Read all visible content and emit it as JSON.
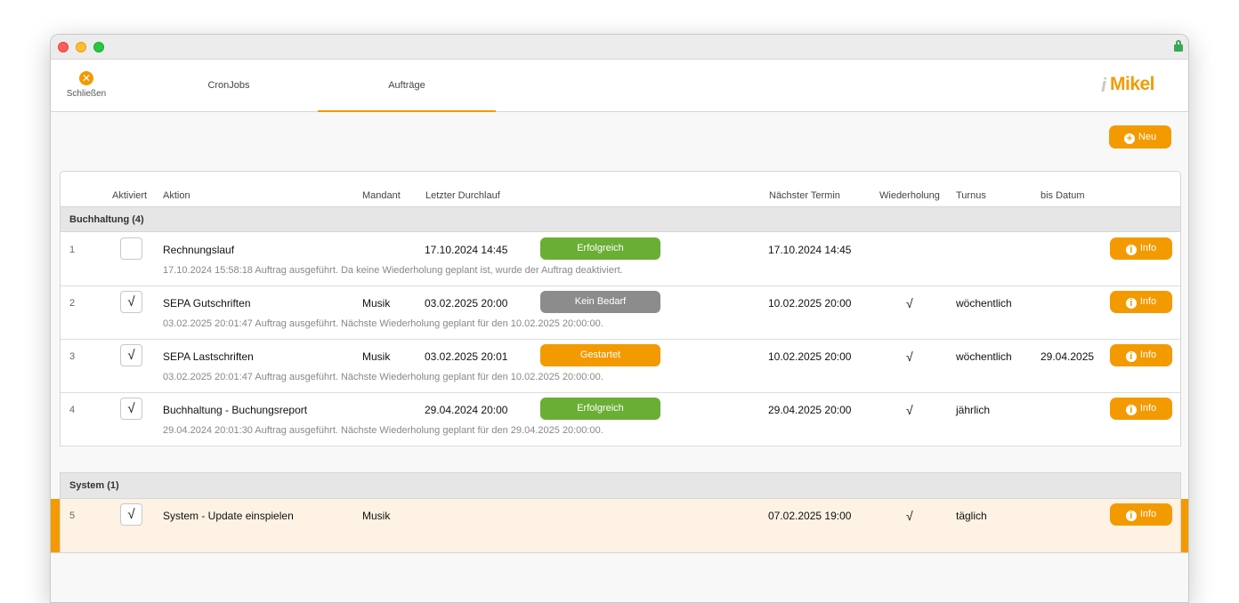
{
  "toolbar": {
    "close_label": "Schließen",
    "tabs": [
      {
        "label": "CronJobs",
        "active": false
      },
      {
        "label": "Aufträge",
        "active": true
      }
    ],
    "logo_i": "i",
    "logo_text": "Mikel"
  },
  "actions": {
    "neu_label": "Neu"
  },
  "columns": {
    "aktiviert": "Aktiviert",
    "aktion": "Aktion",
    "mandant": "Mandant",
    "letzter": "Letzter Durchlauf",
    "naechster": "Nächster Termin",
    "wiederholung": "Wiederholung",
    "turnus": "Turnus",
    "bis": "bis Datum"
  },
  "groups": [
    {
      "title": "Buchhaltung (4)",
      "rows": [
        {
          "index": "1",
          "active_mark": "",
          "action": "Rechnungslauf",
          "mandant": "",
          "letzter": "17.10.2024 14:45",
          "status": "Erfolgreich",
          "naechster": "17.10.2024 14:45",
          "wiederholung": "",
          "turnus": "",
          "bis": "",
          "info": "Info",
          "message": "17.10.2024 15:58:18 Auftrag ausgeführt. Da keine Wiederholung geplant ist, wurde der Auftrag deaktiviert."
        },
        {
          "index": "2",
          "active_mark": "√",
          "action": "SEPA Gutschriften",
          "mandant": "Musik",
          "letzter": "03.02.2025 20:00",
          "status": "Kein Bedarf",
          "naechster": "10.02.2025 20:00",
          "wiederholung": "√",
          "turnus": "wöchentlich",
          "bis": "",
          "info": "Info",
          "message": "03.02.2025 20:01:47 Auftrag ausgeführt. Nächste Wiederholung geplant für den 10.02.2025 20:00:00."
        },
        {
          "index": "3",
          "active_mark": "√",
          "action": "SEPA Lastschriften",
          "mandant": "Musik",
          "letzter": "03.02.2025 20:01",
          "status": "Gestartet",
          "naechster": "10.02.2025 20:00",
          "wiederholung": "√",
          "turnus": "wöchentlich",
          "bis": "29.04.2025",
          "info": "Info",
          "message": "03.02.2025 20:01:47 Auftrag ausgeführt. Nächste Wiederholung geplant für den 10.02.2025 20:00:00."
        },
        {
          "index": "4",
          "active_mark": "√",
          "action": "Buchhaltung - Buchungsreport",
          "mandant": "",
          "letzter": "29.04.2024 20:00",
          "status": "Erfolgreich",
          "naechster": "29.04.2025 20:00",
          "wiederholung": "√",
          "turnus": "jährlich",
          "bis": "",
          "info": "Info",
          "message": "29.04.2024 20:01:30 Auftrag ausgeführt. Nächste Wiederholung geplant für den 29.04.2025 20:00:00."
        }
      ]
    },
    {
      "title": "System (1)",
      "rows": [
        {
          "index": "5",
          "active_mark": "√",
          "action": "System - Update einspielen",
          "mandant": "Musik",
          "letzter": "",
          "status": "",
          "naechster": "07.02.2025 19:00",
          "wiederholung": "√",
          "turnus": "täglich",
          "bis": "",
          "info": "Info",
          "message": ""
        }
      ]
    }
  ],
  "status_colors": {
    "Erfolgreich": "#6aae35",
    "Kein Bedarf": "#8c8c8c",
    "Gestartet": "#f39a00"
  },
  "accent_color": "#f39a00",
  "icons": {
    "close": "close-icon",
    "add": "plus-circle-icon",
    "info": "info-circle-icon",
    "lock": "lock-icon"
  }
}
